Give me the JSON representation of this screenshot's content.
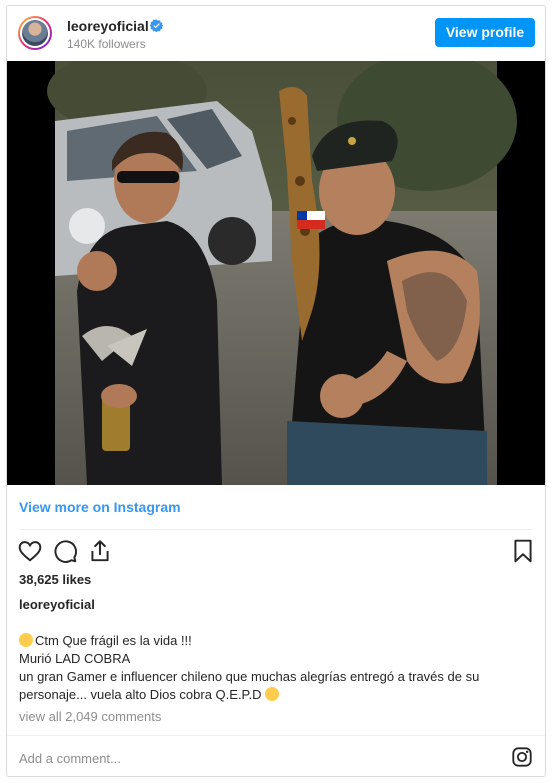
{
  "header": {
    "username": "leoreyoficial",
    "followers": "140K followers",
    "view_profile_label": "View profile"
  },
  "icons": {
    "verified": "verified-badge-icon",
    "like": "heart-icon",
    "comment": "comment-icon",
    "share": "share-icon",
    "save": "bookmark-icon",
    "brand": "instagram-icon"
  },
  "colors": {
    "accent": "#0095f6",
    "link": "#3897f0",
    "verified": "#3897f0"
  },
  "post": {
    "view_more_label": "View more on Instagram",
    "likes": "38,625 likes",
    "owner": "leoreyoficial",
    "caption_line1": "Ctm Que frágil es la vida !!!",
    "caption_line2": "Murió LAD COBRA",
    "caption_line3": "un gran Gamer e influencer chileno que muchas alegrías entregó a través de su",
    "caption_line4": "personaje... vuela alto Dios cobra Q.E.P.D",
    "view_comments": "view all 2,049 comments",
    "add_comment_placeholder": "Add a comment..."
  }
}
